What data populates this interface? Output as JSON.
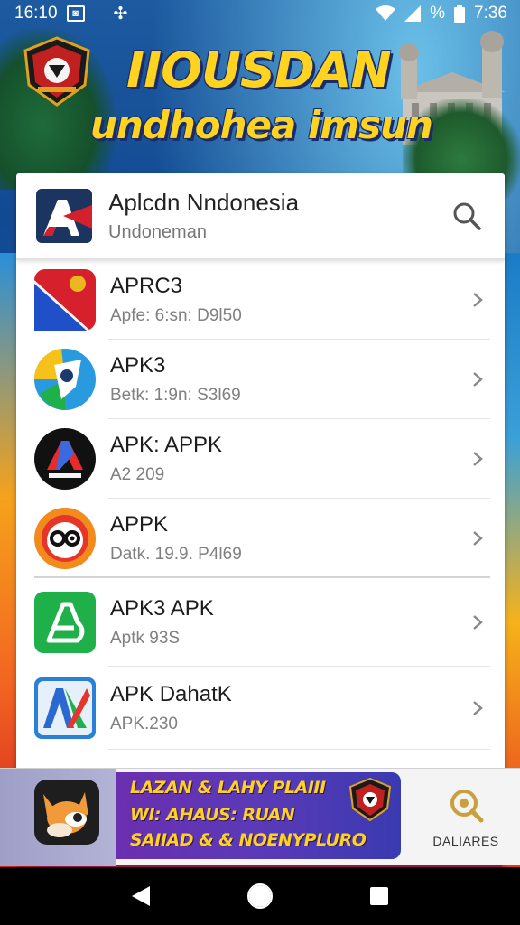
{
  "status_bar": {
    "time_left": "16:10",
    "battery_percent": "%",
    "time_right": "7:36"
  },
  "header": {
    "title": "IIOUSDAN",
    "subtitle": "undhohea imsun"
  },
  "card": {
    "title": "Aplcdn Nndonesia",
    "subtitle": "Undoneman"
  },
  "apps": [
    {
      "name": "APRC3",
      "meta": "Apfe: 6:sn: D9l50",
      "icon": "flag-app-icon"
    },
    {
      "name": "APK3",
      "meta": "Betk: 1:9n: S3l69",
      "icon": "shield-app-icon"
    },
    {
      "name": "APK: APPK",
      "meta": "A2 209",
      "icon": "apkop-app-icon"
    },
    {
      "name": "APPK",
      "meta": "Datk. 19.9. P4l69",
      "icon": "owl-app-icon"
    },
    {
      "name": "APK3 APK",
      "meta": "Aptk 93S",
      "icon": "green-a-app-icon"
    },
    {
      "name": "APK DahatK",
      "meta": "APK.230",
      "icon": "ax-app-icon"
    }
  ],
  "ad": {
    "line1": "LAZAN & LAHY PLAIII",
    "line2": "WI: AHAUS: RUAN",
    "line3": "SAIIAD & & NOENYPLURO",
    "right_label": "DALIARES"
  },
  "colors": {
    "title_yellow": "#ffd320",
    "title_outline": "#1a2b6b",
    "card_bg": "#ffffff",
    "ad_purple": "#6a2fb0"
  }
}
